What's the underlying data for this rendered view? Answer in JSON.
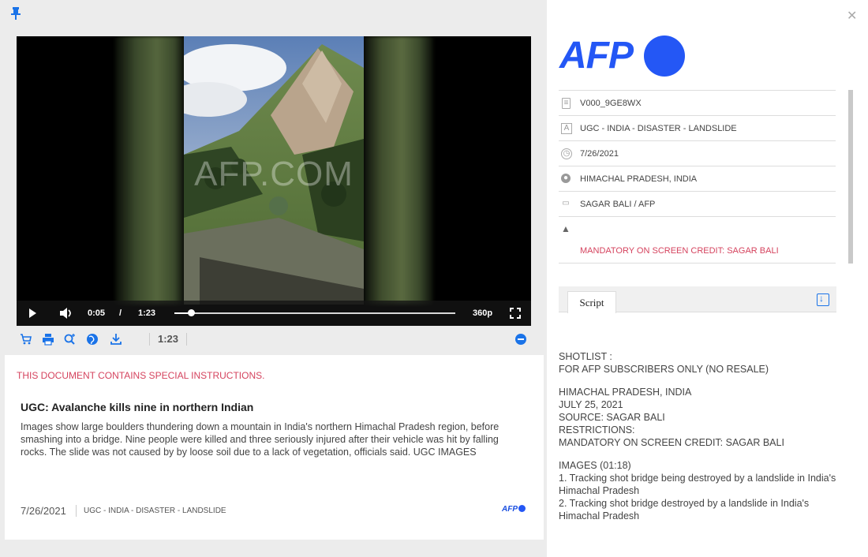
{
  "left": {
    "video": {
      "watermark": "AFP.COM",
      "current_time": "0:05",
      "separator": "/",
      "duration": "1:23",
      "progress_fraction": 0.06,
      "quality": "360p"
    },
    "toolbar": {
      "duration": "1:23",
      "icons": [
        "cart-icon",
        "print-icon",
        "zoom-in-icon",
        "globe-icon",
        "download-icon",
        "collapse-icon"
      ]
    },
    "card": {
      "special": "THIS DOCUMENT CONTAINS SPECIAL INSTRUCTIONS.",
      "title": "UGC: Avalanche kills nine in northern Indian",
      "description": "Images show large boulders thundering down a mountain in India's northern Himachal Pradesh region, before smashing into a bridge. Nine people were killed and three seriously injured after their vehicle was hit by falling rocks. The slide was not caused by by loose soil due to a lack of vegetation, officials said. UGC IMAGES",
      "date": "7/26/2021",
      "slug": "UGC - INDIA - DISASTER - LANDSLIDE",
      "logo": "AFP"
    }
  },
  "right": {
    "logo": "AFP",
    "meta": {
      "id": "V000_9GE8WX",
      "slug": "UGC - INDIA - DISASTER - LANDSLIDE",
      "date": "7/26/2021",
      "location": "HIMACHAL PRADESH, INDIA",
      "credit": "SAGAR BALI / AFP",
      "restriction": "MANDATORY ON SCREEN CREDIT: SAGAR BALI"
    },
    "tab": "Script",
    "script": {
      "p1": [
        "SHOTLIST :",
        "FOR AFP SUBSCRIBERS ONLY (NO RESALE)"
      ],
      "p2": [
        "HIMACHAL PRADESH, INDIA",
        "JULY 25, 2021",
        "SOURCE: SAGAR BALI",
        "RESTRICTIONS:",
        "MANDATORY ON SCREEN CREDIT: SAGAR BALI"
      ],
      "p3": [
        "IMAGES (01:18)",
        "1. Tracking shot bridge being destroyed by a landslide in India's Himachal Pradesh",
        "2. Tracking shot bridge destroyed by a landslide in India's Himachal Pradesh"
      ]
    }
  },
  "colors": {
    "accent": "#2457f5",
    "warning": "#d5435e",
    "link": "#1a73e8"
  }
}
